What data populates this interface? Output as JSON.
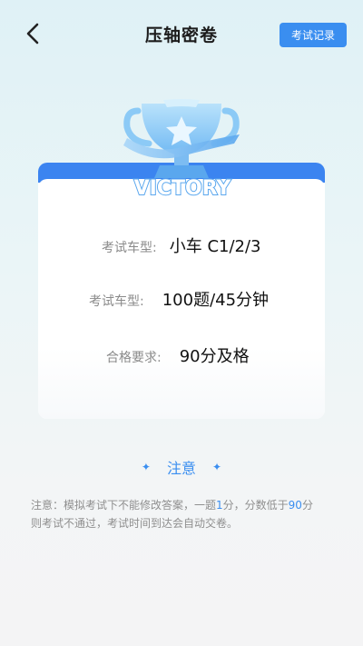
{
  "header": {
    "title": "压轴密卷",
    "record_button": "考试记录"
  },
  "badge": {
    "text": "VICTORY"
  },
  "info": [
    {
      "label": "考试车型:",
      "value": "小车 C1/2/3"
    },
    {
      "label": "考试车型:",
      "value": "100题/45分钟"
    },
    {
      "label": "合格要求:",
      "value": "90分及格"
    }
  ],
  "notice": {
    "title": "注意",
    "text_part1": "注意：模拟考试下不能修改答案，一题",
    "score_per_question": "1",
    "text_part2": "分，分数低于",
    "pass_score": "90",
    "text_part3": "分",
    "text_line2": "则考试不通过，考试时间到达会自动交卷。"
  },
  "colors": {
    "accent": "#3a8ef0",
    "card_band": "#3b84f0"
  },
  "icons": {
    "back": "chevron-left-icon",
    "trophy": "trophy-icon",
    "sparkle": "sparkle-icon"
  }
}
